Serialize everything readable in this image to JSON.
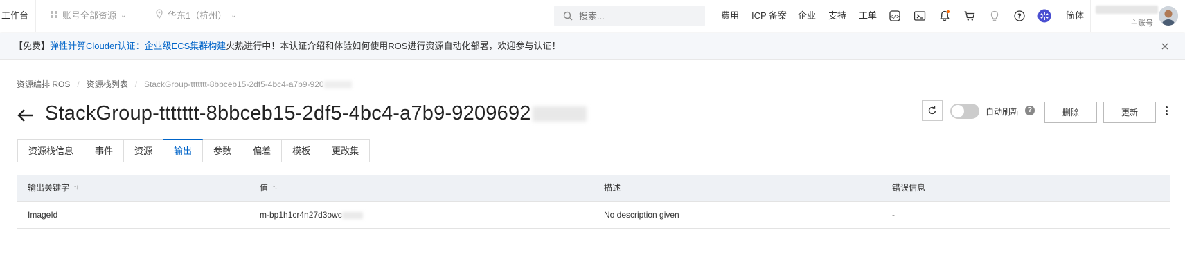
{
  "topbar": {
    "workspace": "工作台",
    "resource_scope": "账号全部资源",
    "region": "华东1（杭州）",
    "search_placeholder": "搜索...",
    "links": [
      "费用",
      "ICP 备案",
      "企业",
      "支持",
      "工单"
    ],
    "icons": [
      "code-icon",
      "terminal-icon",
      "bell-icon",
      "cart-icon",
      "lightbulb-icon",
      "help-icon",
      "brand-icon"
    ],
    "language": "简体",
    "account_role": "主账号"
  },
  "notice": {
    "prefix": "【免费】",
    "link1": "弹性计算Clouder认证：",
    "link2": "企业级ECS集群构建",
    "text": "火热进行中！本认证介绍和体验如何使用ROS进行资源自动化部署，欢迎参与认证！"
  },
  "breadcrumb": {
    "items": [
      "资源编排 ROS",
      "资源栈列表",
      "StackGroup-ttttttt-8bbceb15-2df5-4bc4-a7b9-920"
    ]
  },
  "header": {
    "title": "StackGroup-ttttttt-8bbceb15-2df5-4bc4-a7b9-9209692",
    "auto_refresh_label": "自动刷新",
    "delete_label": "删除",
    "update_label": "更新"
  },
  "tabs": [
    "资源栈信息",
    "事件",
    "资源",
    "输出",
    "参数",
    "偏差",
    "模板",
    "更改集"
  ],
  "active_tab": "输出",
  "table": {
    "headers": [
      "输出关键字",
      "值",
      "描述",
      "错误信息"
    ],
    "rows": [
      {
        "key": "ImageId",
        "value": "m-bp1h1cr4n27d3owc",
        "description": "No description given",
        "error": "-"
      }
    ]
  },
  "colors": {
    "accent": "#0064c8",
    "header_bg": "#eef1f5",
    "notice_bg": "#f5f7fa"
  }
}
